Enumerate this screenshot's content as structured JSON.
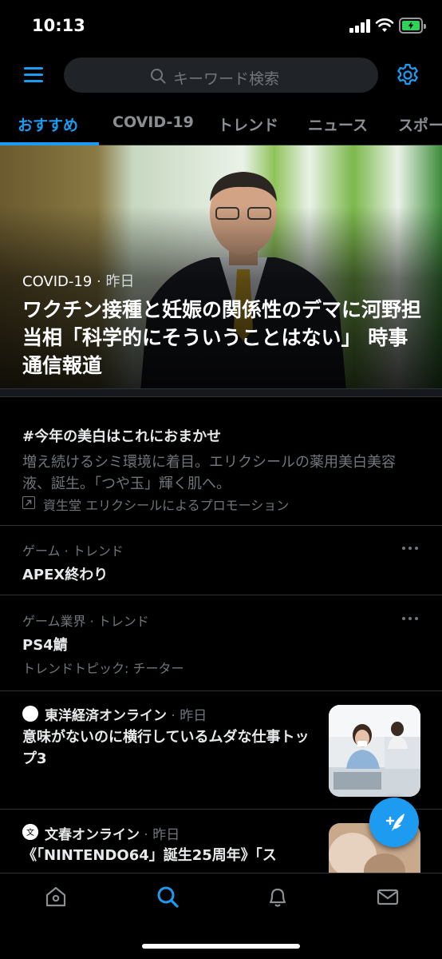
{
  "status_bar": {
    "time": "10:13"
  },
  "search": {
    "placeholder": "キーワード検索"
  },
  "tabs": [
    {
      "label": "おすすめ",
      "active": true
    },
    {
      "label": "COVID-19"
    },
    {
      "label": "トレンド"
    },
    {
      "label": "ニュース"
    },
    {
      "label": "スポー"
    }
  ],
  "hero": {
    "category": "COVID-19",
    "time": " · 昨日",
    "title": "ワクチン接種と妊娠の関係性のデマに河野担当相「科学的にそういうことはない」 時事通信報道"
  },
  "promo": {
    "title": "#今年の美白はこれにおまかせ",
    "body": "増え続けるシミ環境に着目。エリクシールの薬用美白美容液、誕生。「つや玉」輝く肌へ。",
    "promoted_by": "資生堂 エリクシールによるプロモーション"
  },
  "trends": [
    {
      "category": "ゲーム · トレンド",
      "name": "APEX終わり"
    },
    {
      "category": "ゲーム業界 · トレンド",
      "name": "PS4鯖",
      "extra": "トレンドトピック: チーター"
    }
  ],
  "news": [
    {
      "source": "東洋経済オンライン",
      "time": " · 昨日",
      "title": "意味がないのに横行しているムダな仕事トップ3"
    },
    {
      "source": "文春オンライン",
      "time": " · 昨日",
      "title": "《「NINTENDO64」誕生25周年》「ス"
    }
  ],
  "colors": {
    "accent": "#1d9bf0",
    "background": "#000000",
    "muted": "#71767b"
  },
  "icons": {
    "menu": "menu-icon",
    "search": "search-icon",
    "settings": "gear-icon",
    "compose": "compose-tweet-icon",
    "home": "home-icon",
    "explore": "search-icon",
    "notifications": "bell-icon",
    "messages": "envelope-icon"
  }
}
